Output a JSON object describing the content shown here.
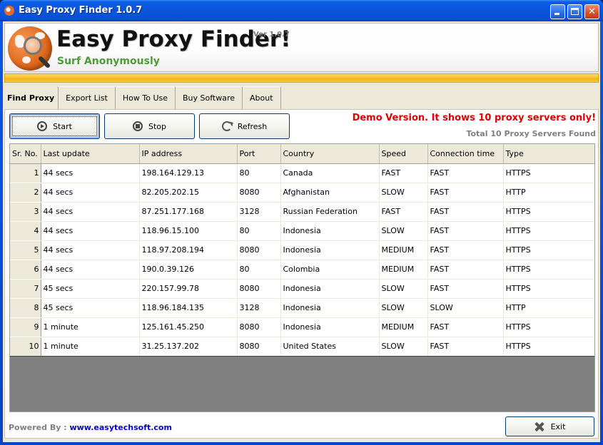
{
  "window": {
    "title": "Easy Proxy Finder 1.0.7",
    "controls": {
      "minimize": "minimize",
      "maximize": "maximize",
      "close": "close"
    }
  },
  "header": {
    "app_name": "Easy Proxy Finder!",
    "version": "Ver 1.0.7",
    "tagline": "Surf Anonymously"
  },
  "tabs": [
    {
      "label": "Find Proxy",
      "active": true
    },
    {
      "label": "Export List",
      "active": false
    },
    {
      "label": "How To Use",
      "active": false
    },
    {
      "label": "Buy Software",
      "active": false
    },
    {
      "label": "About",
      "active": false
    }
  ],
  "toolbar": {
    "start_label": "Start",
    "stop_label": "Stop",
    "refresh_label": "Refresh"
  },
  "notices": {
    "demo": "Demo Version. It shows 10 proxy servers only!",
    "total": "Total 10 Proxy Servers Found"
  },
  "table": {
    "columns": [
      "Sr. No.",
      "Last update",
      "IP address",
      "Port",
      "Country",
      "Speed",
      "Connection time",
      "Type"
    ],
    "rows": [
      [
        "1",
        "44 secs",
        "198.164.129.13",
        "80",
        "Canada",
        "FAST",
        "FAST",
        "HTTPS"
      ],
      [
        "2",
        "44 secs",
        "82.205.202.15",
        "8080",
        "Afghanistan",
        "SLOW",
        "FAST",
        "HTTP"
      ],
      [
        "3",
        "44 secs",
        "87.251.177.168",
        "3128",
        "Russian Federation",
        "FAST",
        "FAST",
        "HTTPS"
      ],
      [
        "4",
        "44 secs",
        "118.96.15.100",
        "80",
        "Indonesia",
        "SLOW",
        "FAST",
        "HTTPS"
      ],
      [
        "5",
        "44 secs",
        "118.97.208.194",
        "8080",
        "Indonesia",
        "MEDIUM",
        "FAST",
        "HTTPS"
      ],
      [
        "6",
        "44 secs",
        "190.0.39.126",
        "80",
        "Colombia",
        "MEDIUM",
        "FAST",
        "HTTPS"
      ],
      [
        "7",
        "45 secs",
        "220.157.99.78",
        "8080",
        "Indonesia",
        "SLOW",
        "FAST",
        "HTTPS"
      ],
      [
        "8",
        "45 secs",
        "118.96.184.135",
        "3128",
        "Indonesia",
        "SLOW",
        "SLOW",
        "HTTP"
      ],
      [
        "9",
        "1 minute",
        "125.161.45.250",
        "8080",
        "Indonesia",
        "MEDIUM",
        "FAST",
        "HTTPS"
      ],
      [
        "10",
        "1 minute",
        "31.25.137.202",
        "8080",
        "United States",
        "SLOW",
        "FAST",
        "HTTPS"
      ]
    ]
  },
  "footer": {
    "powered_label": "Powered By : ",
    "link_text": "www.easytechsoft.com",
    "exit_label": "Exit"
  }
}
